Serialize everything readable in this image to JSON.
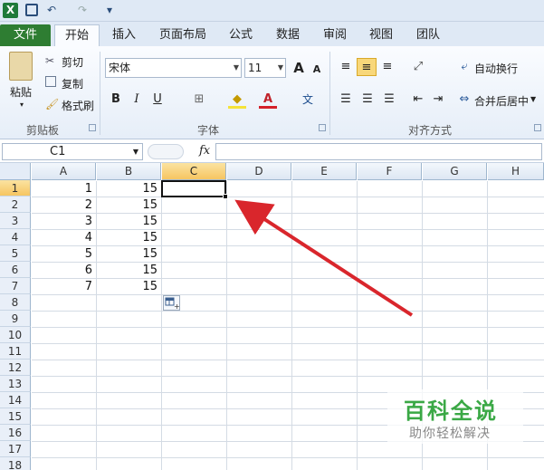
{
  "qat": {
    "undo": "↶",
    "redo": "↷",
    "customize": "▾"
  },
  "tabs": [
    "文件",
    "开始",
    "插入",
    "页面布局",
    "公式",
    "数据",
    "审阅",
    "视图",
    "团队"
  ],
  "ribbon": {
    "clipboard": {
      "paste": "粘贴",
      "cut": "剪切",
      "copy": "复制",
      "format_painter": "格式刷",
      "label": "剪贴板"
    },
    "font": {
      "name": "宋体",
      "size": "11",
      "grow": "A",
      "shrink": "A",
      "bold": "B",
      "italic": "I",
      "underline": "U",
      "label": "字体",
      "phonetic": "文"
    },
    "alignment": {
      "wrap": "自动换行",
      "merge": "合并后居中",
      "label": "对齐方式"
    }
  },
  "formula_bar": {
    "name_box": "C1",
    "fx": "fx",
    "content": ""
  },
  "columns": [
    "A",
    "B",
    "C",
    "D",
    "E",
    "F",
    "G",
    "H"
  ],
  "rows": [
    "1",
    "2",
    "3",
    "4",
    "5",
    "6",
    "7",
    "8",
    "9",
    "10",
    "11",
    "12",
    "13",
    "14",
    "15",
    "16",
    "17",
    "18"
  ],
  "col_a": [
    "1",
    "2",
    "3",
    "4",
    "5",
    "6",
    "7"
  ],
  "col_b": [
    "15",
    "15",
    "15",
    "15",
    "15",
    "15",
    "15"
  ],
  "selected_cell": "C1",
  "watermark": {
    "title": "百科全说",
    "subtitle": "助你轻松解决"
  },
  "colors": {
    "file_tab": "#2e7d32",
    "selection": "#f6c561",
    "arrow": "#d9262c",
    "watermark": "#3aa845"
  }
}
